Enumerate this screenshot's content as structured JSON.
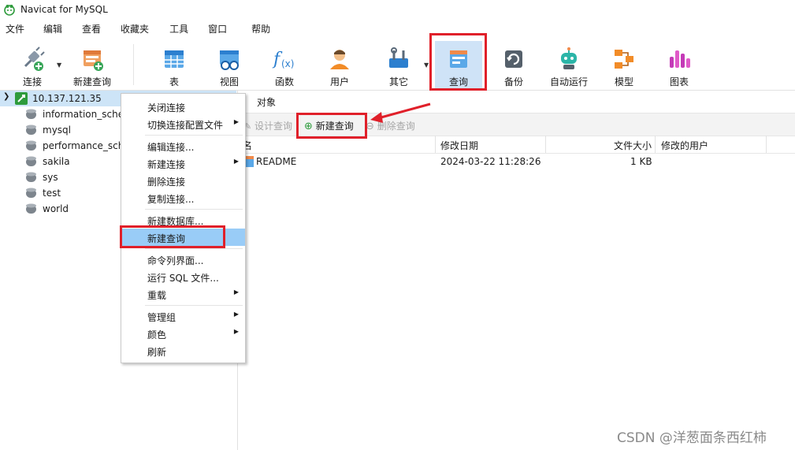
{
  "window": {
    "title": "Navicat for MySQL"
  },
  "menubar": [
    "文件",
    "编辑",
    "查看",
    "收藏夹",
    "工具",
    "窗口",
    "帮助"
  ],
  "toolbar": {
    "connect": "连接",
    "new_query": "新建查询",
    "table": "表",
    "view": "视图",
    "function": "函数",
    "user": "用户",
    "other": "其它",
    "query": "查询",
    "backup": "备份",
    "auto_run": "自动运行",
    "model": "模型",
    "chart": "图表"
  },
  "sidebar": {
    "connection": "10.137.121.35",
    "databases": [
      "information_schema",
      "mysql",
      "performance_schema",
      "sakila",
      "sys",
      "test",
      "world"
    ]
  },
  "context_menu": {
    "items": [
      "关闭连接",
      "切换连接配置文件",
      "编辑连接...",
      "新建连接",
      "删除连接",
      "复制连接...",
      "新建数据库...",
      "新建查询",
      "命令列界面...",
      "运行 SQL 文件...",
      "重载",
      "管理组",
      "颜色",
      "刷新"
    ],
    "highlighted": "新建查询"
  },
  "main": {
    "tab": "对象",
    "obj_toolbar": {
      "design": "设计查询",
      "new": "新建查询",
      "delete": "删除查询"
    },
    "columns": [
      "名",
      "修改日期",
      "文件大小",
      "修改的用户"
    ],
    "rows": [
      {
        "name": "README",
        "modified": "2024-03-22 11:28:26",
        "size": "1 KB",
        "user": ""
      }
    ]
  },
  "watermark": "CSDN @洋葱面条西红柿",
  "colors": {
    "accent_red": "#e0202a",
    "selection": "#cde4f7",
    "highlight": "#99ccf7"
  }
}
